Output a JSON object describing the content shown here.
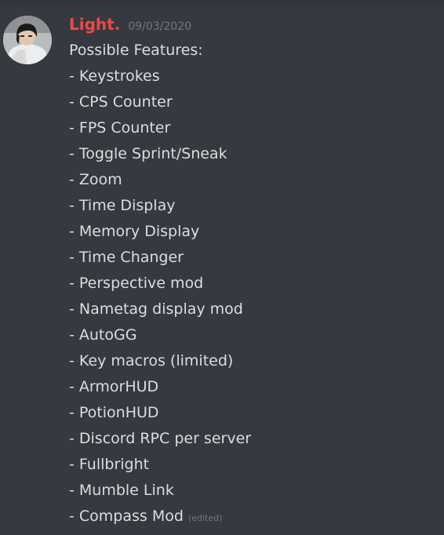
{
  "message": {
    "author": "Light.",
    "timestamp": "09/03/2020",
    "edited_tag": "(edited)",
    "lines": [
      "Possible Features:",
      "- Keystrokes",
      "- CPS Counter",
      "- FPS Counter",
      "- Toggle Sprint/Sneak",
      "- Zoom",
      "- Time Display",
      "- Memory Display",
      "- Time Changer",
      "- Perspective mod",
      "- Nametag display mod",
      "- AutoGG",
      "- Key macros (limited)",
      "- ArmorHUD",
      "- PotionHUD",
      "- Discord RPC per server",
      "- Fullbright",
      "- Mumble Link",
      "- Compass Mod"
    ]
  },
  "colors": {
    "background": "#36393f",
    "username": "#f04747",
    "text": "#dcddde",
    "muted": "#72767d"
  }
}
